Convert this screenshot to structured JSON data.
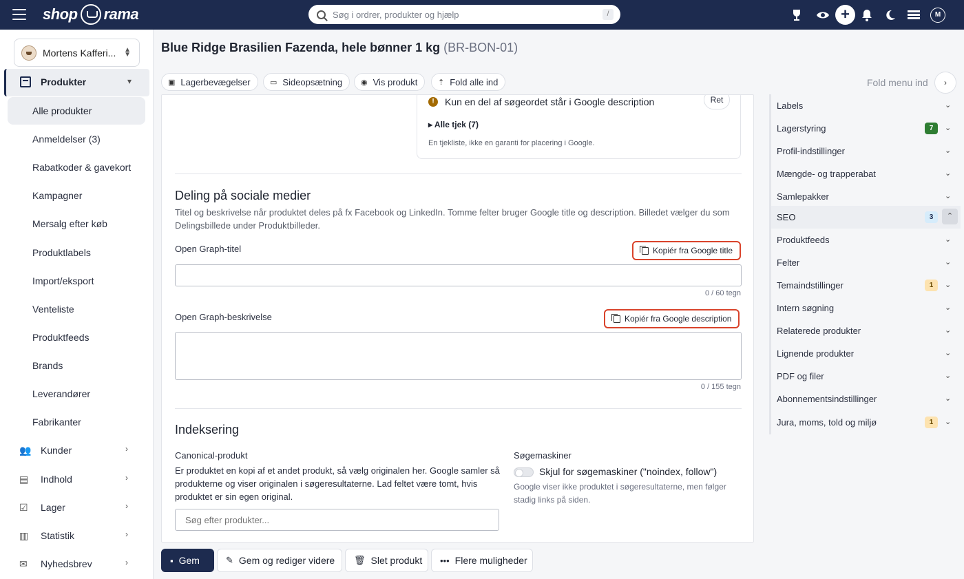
{
  "app": {
    "logo_left": "shop",
    "logo_right": "rama"
  },
  "search": {
    "placeholder": "Søg i ordrer, produkter og hjælp",
    "shortcut": "/"
  },
  "topbar": {
    "avatar_initial": "M"
  },
  "sidebar": {
    "shop_name": "Mortens Kafferi...",
    "main_item": "Produkter",
    "sub_items": [
      {
        "label": "Alle produkter"
      },
      {
        "label": "Anmeldelser (3)"
      },
      {
        "label": "Rabatkoder & gavekort"
      },
      {
        "label": "Kampagner"
      },
      {
        "label": "Mersalg efter køb"
      },
      {
        "label": "Produktlabels"
      },
      {
        "label": "Import/eksport"
      },
      {
        "label": "Venteliste"
      },
      {
        "label": "Produktfeeds"
      },
      {
        "label": "Brands"
      },
      {
        "label": "Leverandører"
      },
      {
        "label": "Fabrikanter"
      }
    ],
    "groups": [
      {
        "label": "Kunder"
      },
      {
        "label": "Indhold"
      },
      {
        "label": "Lager"
      },
      {
        "label": "Statistik"
      },
      {
        "label": "Nyhedsbrev"
      }
    ]
  },
  "header": {
    "title": "Blue Ridge Brasilien Fazenda, hele bønner 1 kg",
    "sku": "(BR-BON-01)",
    "chips": [
      "Lagerbevægelser",
      "Sideopsætning",
      "Vis produkt",
      "Fold alle ind"
    ],
    "fold_menu": "Fold menu ind"
  },
  "checks": {
    "warning": "Kun en del af søgeordet står i Google description",
    "ret": "Ret",
    "all_checks": "Alle tjek (7)",
    "note": "En tjekliste, ikke en garanti for placering i Google."
  },
  "social": {
    "title": "Deling på sociale medier",
    "description": "Titel og beskrivelse når produktet deles på fx Facebook og LinkedIn. Tomme felter bruger Google title og description. Billedet vælger du som Delingsbillede under Produktbilleder.",
    "og_title_label": "Open Graph-titel",
    "copy_title": "Kopiér fra Google title",
    "og_title_value": "",
    "og_title_counter": "0 / 60 tegn",
    "og_desc_label": "Open Graph-beskrivelse",
    "copy_desc": "Kopiér fra Google description",
    "og_desc_value": "",
    "og_desc_counter": "0 / 155 tegn"
  },
  "indexing": {
    "title": "Indeksering",
    "canonical_label": "Canonical-produkt",
    "canonical_desc": "Er produktet en kopi af et andet produkt, så vælg originalen her. Google samler så produkterne og viser originalen i søgeresultaterne. Lad feltet være tomt, hvis produktet er sin egen original.",
    "canonical_placeholder": "Søg efter produkter...",
    "search_engines_label": "Søgemaskiner",
    "hide_label": "Skjul for søgemaskiner (\"noindex, follow\")",
    "hide_enabled": false,
    "hide_desc": "Google viser ikke produktet i søgeresultaterne, men følger stadig links på siden."
  },
  "right_panel": [
    {
      "label": "Labels"
    },
    {
      "label": "Lagerstyring",
      "badge": "7",
      "badge_color": "#2e7d32"
    },
    {
      "label": "Profil-indstillinger"
    },
    {
      "label": "Mængde- og trapperabat"
    },
    {
      "label": "Samlepakker"
    },
    {
      "label": "SEO",
      "badge": "3",
      "badge_color": "#d6ecfb",
      "active": true
    },
    {
      "label": "Produktfeeds"
    },
    {
      "label": "Felter"
    },
    {
      "label": "Temaindstillinger",
      "badge": "1",
      "badge_color": "#fde3b0"
    },
    {
      "label": "Intern søgning"
    },
    {
      "label": "Relaterede produkter"
    },
    {
      "label": "Lignende produkter"
    },
    {
      "label": "PDF og filer"
    },
    {
      "label": "Abonnementsindstillinger"
    },
    {
      "label": "Jura, moms, told og miljø",
      "badge": "1",
      "badge_color": "#fde3b0"
    }
  ],
  "bottom": {
    "save": "Gem",
    "save_continue": "Gem og rediger videre",
    "delete": "Slet produkt",
    "more": "Flere muligheder"
  }
}
